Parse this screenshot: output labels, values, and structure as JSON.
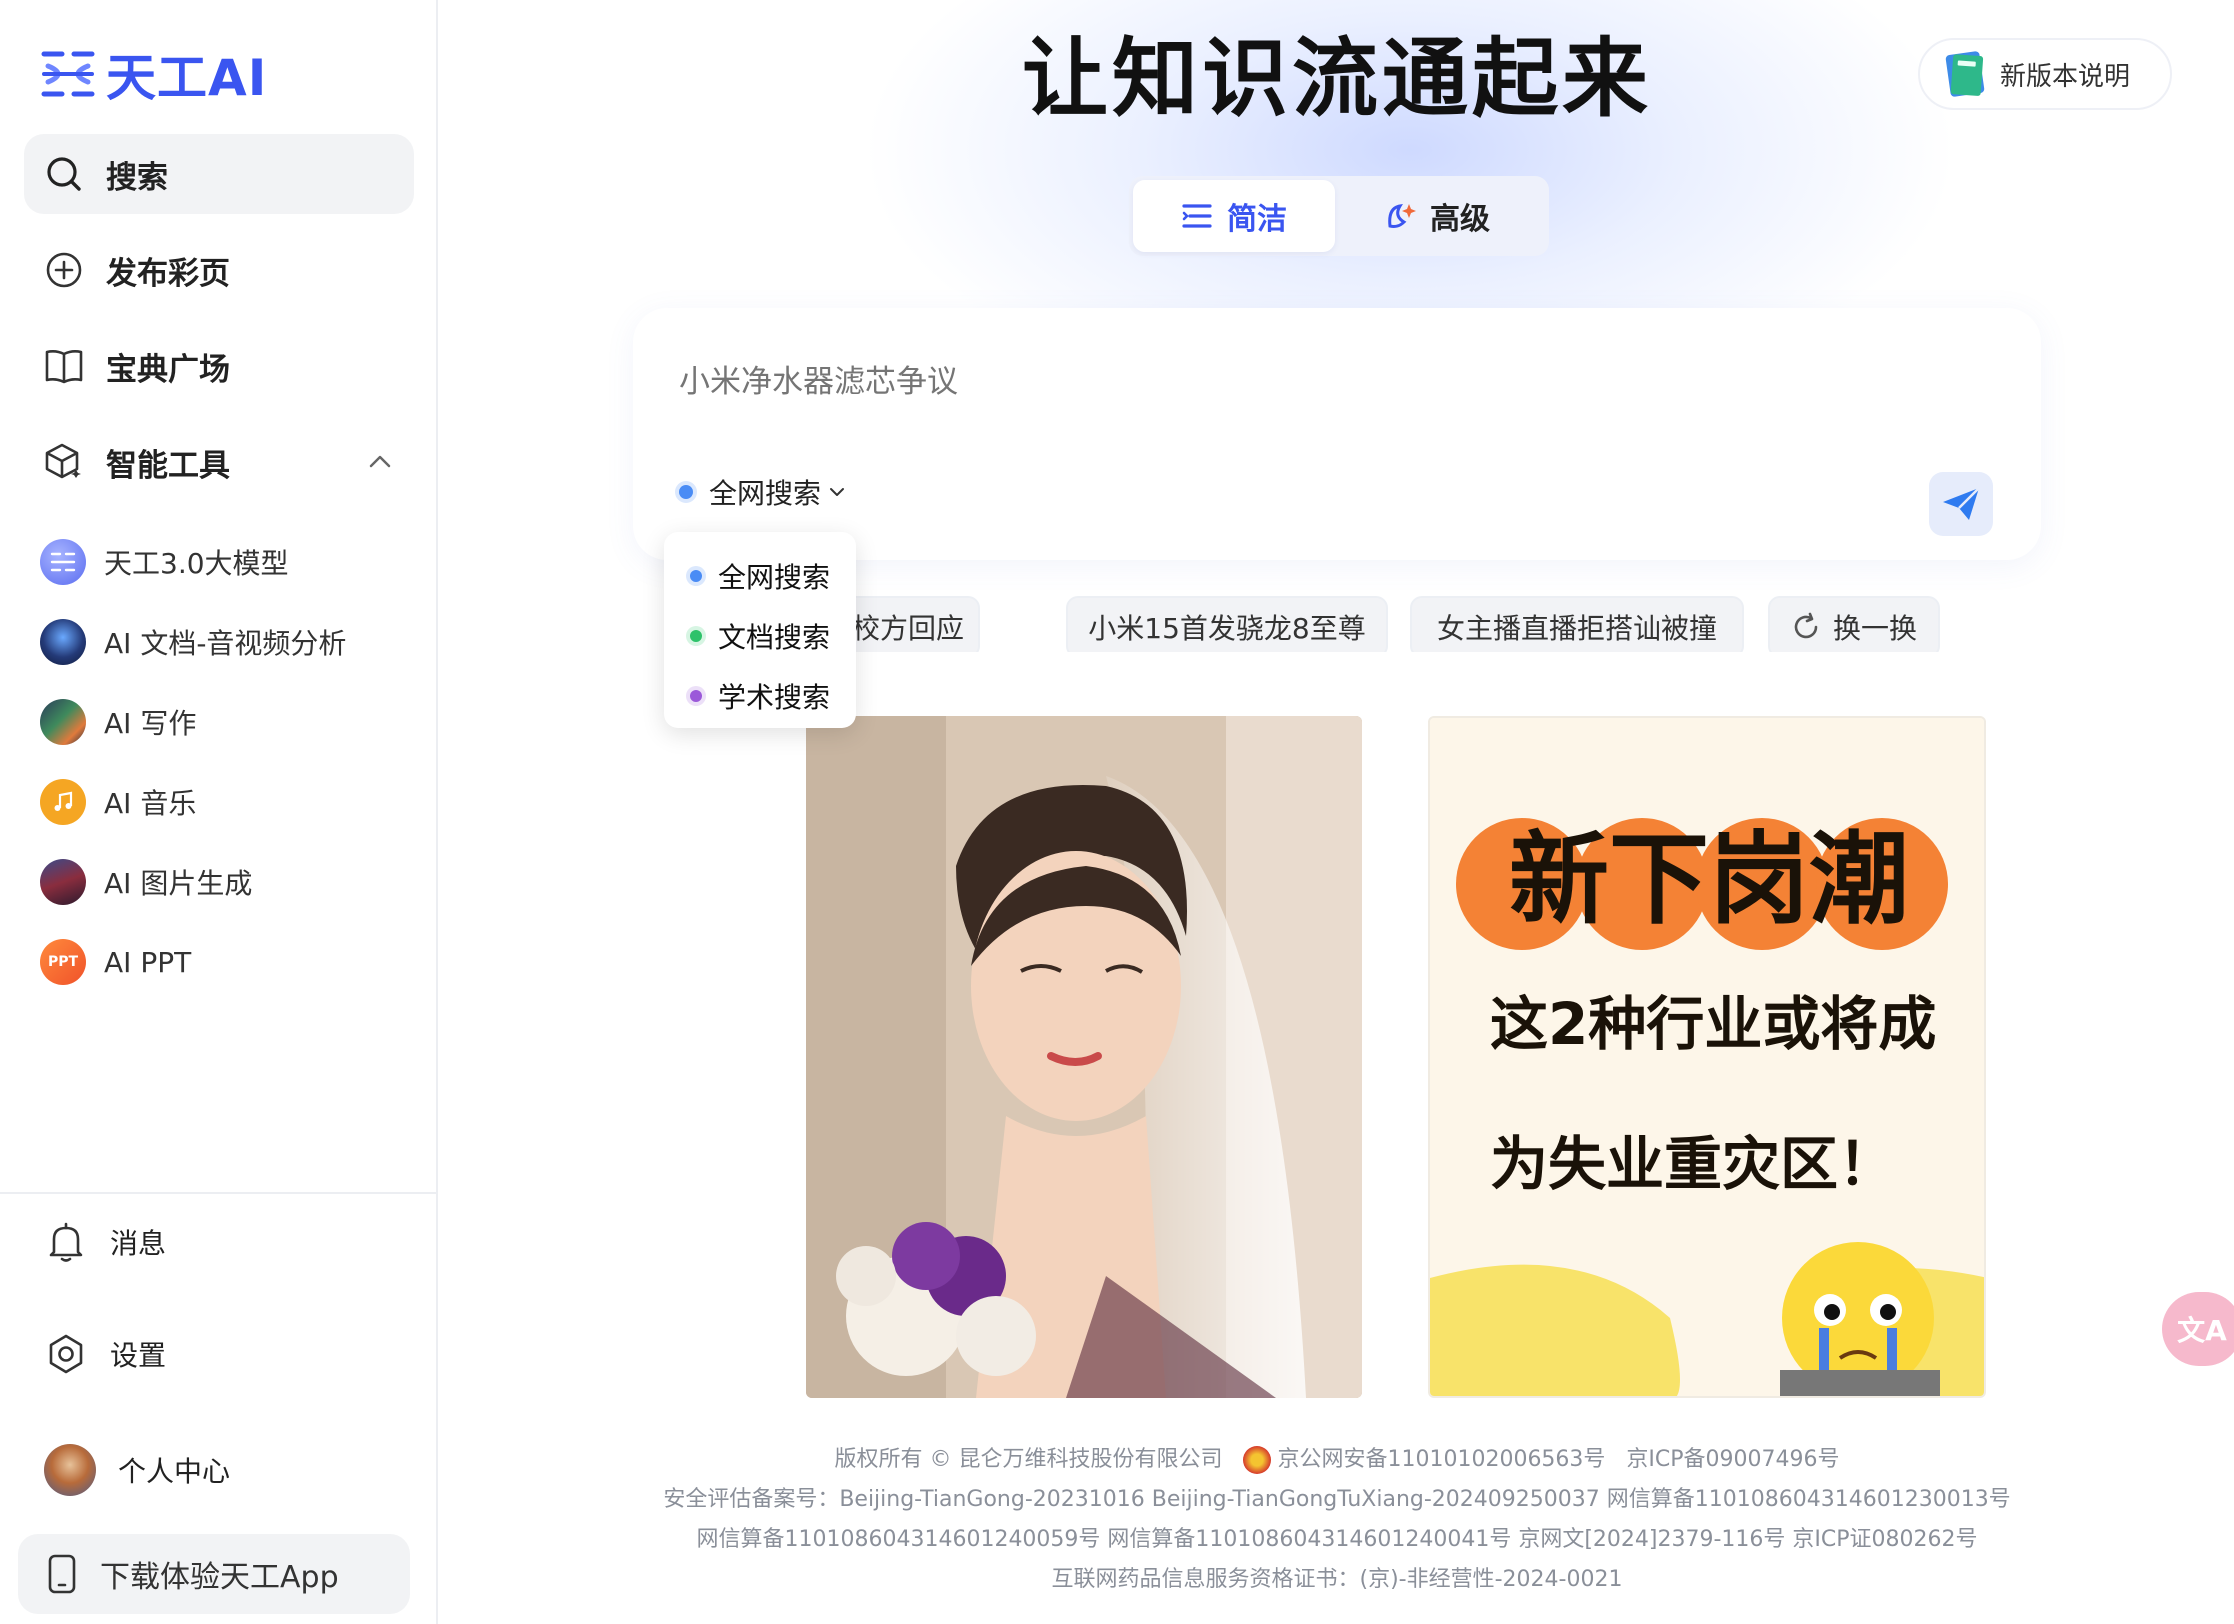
{
  "brand": {
    "logo_text": "天工AI",
    "accent": "#3a55f0"
  },
  "sidebar": {
    "nav": [
      {
        "label": "搜索",
        "icon": "search-icon",
        "active": true
      },
      {
        "label": "发布彩页",
        "icon": "plus-circle-icon"
      },
      {
        "label": "宝典广场",
        "icon": "book-open-icon"
      },
      {
        "label": "智能工具",
        "icon": "cube-sparkle-icon",
        "expanded": true
      }
    ],
    "tools": [
      {
        "label": "天工3.0大模型",
        "icon": "tiangong-model-icon",
        "color": "#6d7cf0"
      },
      {
        "label": "AI 文档-音视频分析",
        "icon": "doc-av-analysis-icon",
        "color": "#2c3e7a"
      },
      {
        "label": "AI 写作",
        "icon": "writing-icon",
        "color": "#2f6b4f"
      },
      {
        "label": "AI 音乐",
        "icon": "music-icon",
        "color": "#f5a623"
      },
      {
        "label": "AI 图片生成",
        "icon": "image-gen-icon",
        "color": "#7a2e4a"
      },
      {
        "label": "AI PPT",
        "icon": "ppt-icon",
        "color": "#f06a2a",
        "badge": "PPT"
      }
    ],
    "bottom": {
      "messages": "消息",
      "settings": "设置",
      "profile": "个人中心",
      "download": "下载体验天工App"
    }
  },
  "main": {
    "title": "让知识流通起来",
    "new_version": "新版本说明",
    "modes": {
      "simple": "简洁",
      "advanced": "高级",
      "selected": "simple"
    },
    "search": {
      "placeholder": "小米净水器滤芯争议",
      "scope": "全网搜索"
    },
    "scope_options": [
      {
        "label": "全网搜索",
        "color": "#4a8cf5"
      },
      {
        "label": "文档搜索",
        "color": "#2ec26a"
      },
      {
        "label": "学术搜索",
        "color": "#9b59d9"
      }
    ],
    "chips": [
      "搜身校方回应",
      "小米15首发骁龙8至尊",
      "女主播直播拒搭讪被撞",
      "换一换"
    ],
    "cards": [
      {
        "alt": "bride-photo"
      },
      {
        "title": "新下岗潮",
        "line1": "这2种行业或将成",
        "line2": "为失业重灾区！"
      }
    ]
  },
  "footer": {
    "line1_a": "版权所有 © 昆仑万维科技股份有限公司",
    "line1_b": "京公网安备11010102006563号",
    "line1_c": "京ICP备09007496号",
    "line2": "安全评估备案号：Beijing-TianGong-20231016 Beijing-TianGongTuXiang-202409250037 网信算备110108604314601230013号",
    "line3": "网信算备110108604314601240059号   网信算备110108604314601240041号 京网文[2024]2379-116号 京ICP证080262号",
    "line4": "互联网药品信息服务资格证书：(京)-非经营性-2024-0021"
  },
  "float": {
    "translate_label": "文A"
  }
}
